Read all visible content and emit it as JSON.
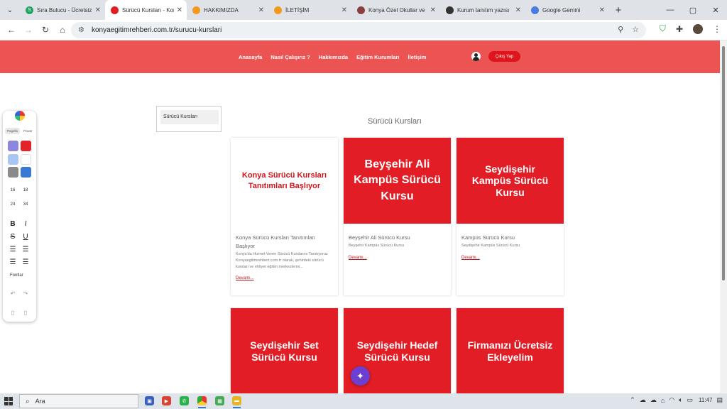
{
  "browser": {
    "tabs": [
      {
        "title": "Sıra Bulucu - Ücretsiz",
        "fav_color": "#1ea362",
        "fav_glyph": "S",
        "active": false
      },
      {
        "title": "Sürücü Kursları - Kon",
        "fav_color": "#e31d25",
        "fav_glyph": "",
        "active": true
      },
      {
        "title": "HAKKIMIZDA",
        "fav_color": "#f39a1e",
        "fav_glyph": "",
        "active": false
      },
      {
        "title": "İLETİŞİM",
        "fav_color": "#f39a1e",
        "fav_glyph": "",
        "active": false
      },
      {
        "title": "Konya Özel Okullar ve",
        "fav_color": "#8b3f3f",
        "fav_glyph": "",
        "active": false
      },
      {
        "title": "Kurum tanıtım yazısı",
        "fav_color": "#333333",
        "fav_glyph": "",
        "active": false
      },
      {
        "title": "Google Gemini",
        "fav_color": "#4a7be0",
        "fav_glyph": "",
        "active": false
      }
    ],
    "url": "konyaegitimrehberi.com.tr/surucu-kurslari"
  },
  "site": {
    "nav": [
      "Anasayfa",
      "Nasıl Çalışırız ?",
      "Hakkımızda",
      "Eğitim Kurumları",
      "İletişim"
    ],
    "logout_label": "Çıkış Yap",
    "sidebar_category": "Sürücü Kursları",
    "section_title": "Sürücü Kursları",
    "cards": [
      {
        "image_text": "Konya Sürücü Kursları Tanıtımları Başlıyor",
        "image_style": "white",
        "title": "Konya Sürücü Kursları Tanıtımları Başlıyor",
        "desc": "Konya'da Hizmet Veren Sürücü Kurslarını Tanıtıyoruz Konyaegitimrehberi.com.tr olarak, şehirdeki sürücü kursları ve ehliyet eğitim merkezlerini...",
        "more": "Devamı..."
      },
      {
        "image_text": "Beyşehir Ali Kampüs Sürücü Kursu",
        "image_style": "red",
        "title": "Beyşehir Ali Sürücü Kursu",
        "desc": "Beyşehir Kampüs Sürücü Kursu",
        "more": "Devamı..."
      },
      {
        "image_text": "Seydişehir Kampüs Sürücü Kursu",
        "image_style": "red",
        "title": "Kampüs Sürücü Kursu",
        "desc": "Seydişehir Kampüs Sürücü Kursu",
        "more": "Devamı..."
      },
      {
        "image_text": "Seydişehir Set Sürücü Kursu",
        "image_style": "red",
        "title": "",
        "desc": "",
        "more": ""
      },
      {
        "image_text": "Seydişehir Hedef Sürücü Kursu",
        "image_style": "red",
        "title": "",
        "desc": "",
        "more": ""
      },
      {
        "image_text": "Firmanızı Ücretsiz Ekleyelim",
        "image_style": "red",
        "title": "",
        "desc": "",
        "more": ""
      }
    ]
  },
  "palette": {
    "tabs": [
      "Pagella",
      "Power"
    ],
    "sizes": [
      "16",
      "18",
      "24",
      "34"
    ],
    "fonts_label": "Fontlar",
    "colors": [
      "#8c87dd",
      "#e2232a",
      "#a9c5f1",
      "#ffffff",
      "#8a8a8a",
      "#3a78d3"
    ]
  },
  "taskbar": {
    "search_placeholder": "Ara",
    "time": "11:47"
  }
}
